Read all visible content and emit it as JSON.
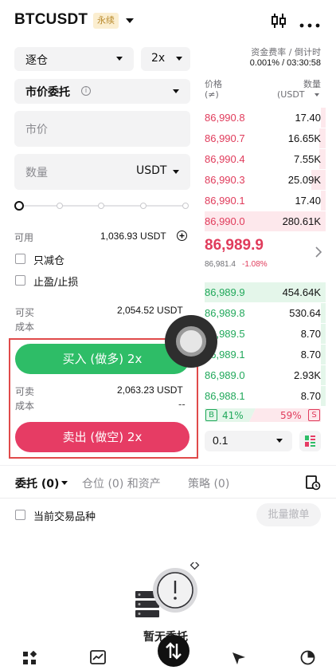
{
  "header": {
    "symbol": "BTCUSDT",
    "badge": "永续"
  },
  "margin_mode": "逐仓",
  "leverage": "2x",
  "order_type": "市价委托",
  "price_field": {
    "placeholder": "市价"
  },
  "quantity_field": {
    "placeholder": "数量",
    "unit": "USDT"
  },
  "slider_level_percent": 0,
  "available": {
    "label": "可用",
    "value": "1,036.93 USDT"
  },
  "options": {
    "reduce_only": "只减仓",
    "tp_sl": "止盈/止损"
  },
  "buy": {
    "label_max": "可买",
    "label_cost": "成本",
    "max_value": "2,054.52 USDT",
    "cost_value": "",
    "button": "买入 (做多) 2x"
  },
  "sell": {
    "label_max": "可卖",
    "label_cost": "成本",
    "max_value": "2,063.23 USDT",
    "cost_value": "--",
    "button": "卖出 (做空) 2x"
  },
  "funding": {
    "label": "资金费率 / 倒计时",
    "value": "0.001% / 03:30:58"
  },
  "orderbook": {
    "price_header": "价格",
    "price_unit": "(≠)",
    "qty_header": "数量",
    "qty_unit": "(USDT",
    "asks": [
      {
        "price": "86,990.8",
        "qty": "17.40",
        "depth": 0.04
      },
      {
        "price": "86,990.7",
        "qty": "16.65K",
        "depth": 0.05
      },
      {
        "price": "86,990.4",
        "qty": "7.55K",
        "depth": 0.05
      },
      {
        "price": "86,990.3",
        "qty": "25.09K",
        "depth": 0.12
      },
      {
        "price": "86,990.1",
        "qty": "17.40",
        "depth": 0.04
      },
      {
        "price": "86,990.0",
        "qty": "280.61K",
        "depth": 1.0
      }
    ],
    "last_price": "86,989.9",
    "mark_price": "86,981.4",
    "change": "-1.08%",
    "bids": [
      {
        "price": "86,989.9",
        "qty": "454.64K",
        "depth": 1.0
      },
      {
        "price": "86,989.8",
        "qty": "530.64",
        "depth": 0.04
      },
      {
        "price": "86,989.5",
        "qty": "8.70",
        "depth": 0.04
      },
      {
        "price": "86,989.1",
        "qty": "8.70",
        "depth": 0.04
      },
      {
        "price": "86,989.0",
        "qty": "2.93K",
        "depth": 0.04
      },
      {
        "price": "86,988.1",
        "qty": "8.70",
        "depth": 0.04
      }
    ],
    "ratio": {
      "buy_tag": "B",
      "buy_pct": "41%",
      "sell_pct": "59%",
      "sell_tag": "S",
      "buy_fraction": 0.41
    },
    "precision": "0.1"
  },
  "tabs": {
    "orders": "委托 (0)",
    "positions": "仓位 (0) 和资产",
    "strategy": "策略 (0)"
  },
  "current_pair_only": "当前交易品种",
  "batch_cancel": "批量撤单",
  "empty_text": "暂无委托",
  "colors": {
    "buy": "#2ebd67",
    "sell": "#e63c64",
    "highlight_box": "#e04a4a"
  }
}
